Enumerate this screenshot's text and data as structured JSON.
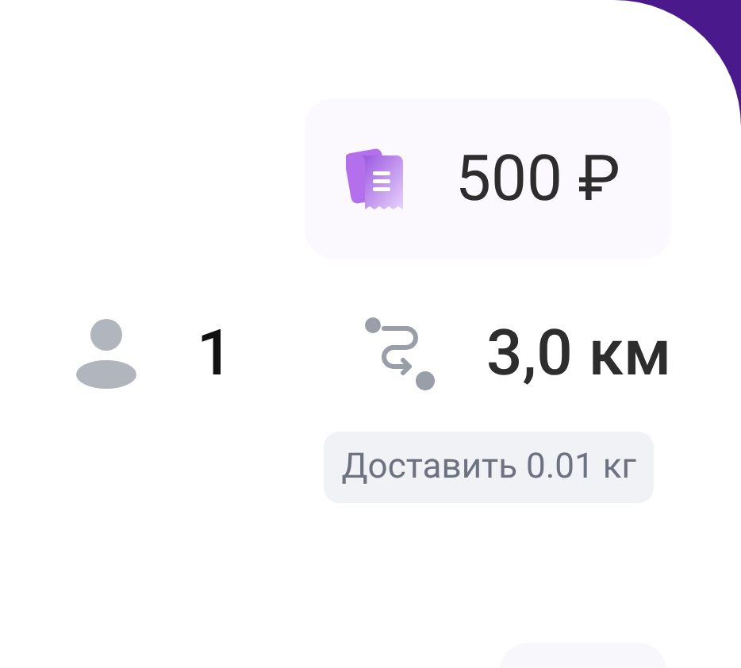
{
  "price": {
    "amount": "500 ₽"
  },
  "stats": [
    {
      "kind": "passengers",
      "value": "1"
    },
    {
      "kind": "distance",
      "value": "3,0 км"
    }
  ],
  "cargo_tag": "Доставить 0.01 кг"
}
